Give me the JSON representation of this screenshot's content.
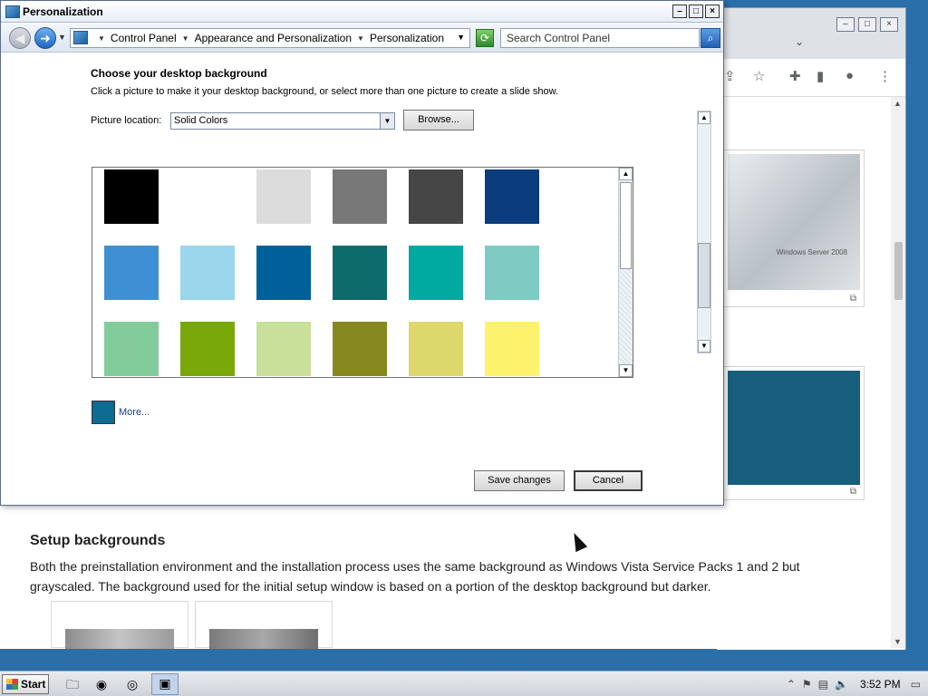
{
  "window": {
    "title": "Personalization",
    "minimize": "–",
    "maximize": "□",
    "close": "×"
  },
  "address": {
    "crumbs": [
      "Control Panel",
      "Appearance and Personalization",
      "Personalization"
    ],
    "search_placeholder": "Search Control Panel"
  },
  "panel": {
    "heading": "Choose your desktop background",
    "instructions": "Click a picture to make it your desktop background, or select more than one picture to create a slide show.",
    "location_label": "Picture location:",
    "location_value": "Solid Colors",
    "browse_label": "Browse...",
    "more_label": "More...",
    "more_color": "#0f6a94",
    "save_label": "Save changes",
    "cancel_label": "Cancel"
  },
  "swatches": [
    [
      "#000000",
      "#ffffff",
      "#dcdcdc",
      "#787878",
      "#464646",
      "#0b3c7d"
    ],
    [
      "#3f8fd4",
      "#9ad6ec",
      "#00609a",
      "#0c6b6b",
      "#00aaa0",
      "#7ecbc4"
    ],
    [
      "#82cc9c",
      "#78a80a",
      "#c8e09a",
      "#85891e",
      "#dcd86c",
      "#fdf26c"
    ]
  ],
  "article": {
    "heading": "Setup backgrounds",
    "text": "Both the preinstallation environment and the installation process uses the same background as Windows Vista Service Packs 1 and 2 but grayscaled. The background used for the initial setup window is based on a portion of the desktop background but darker."
  },
  "browser": {
    "ws_logo": "Windows Server 2008"
  },
  "taskbar": {
    "start_label": "Start",
    "clock": "3:52 PM"
  }
}
